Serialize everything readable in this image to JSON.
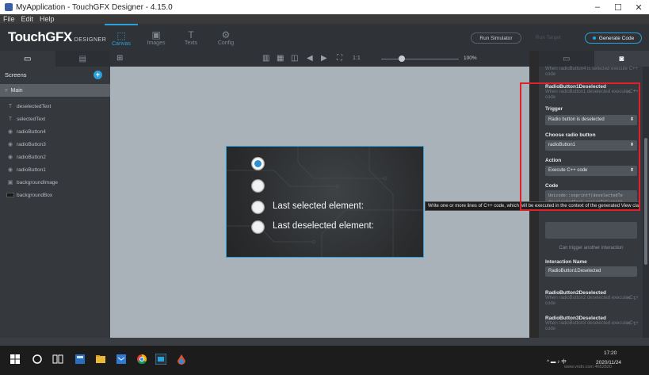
{
  "window": {
    "title": "MyApplication - TouchGFX Designer - 4.15.0",
    "min": "–",
    "max": "☐",
    "close": "✕"
  },
  "menu": [
    "File",
    "Edit",
    "Help"
  ],
  "logo": {
    "main": "TouchGFX",
    "sub": "DESIGNER"
  },
  "tools": [
    {
      "label": "Canvas",
      "icon": "⬚"
    },
    {
      "label": "Images",
      "icon": "▣"
    },
    {
      "label": "Texts",
      "icon": "T"
    },
    {
      "label": "Config",
      "icon": "⚙"
    }
  ],
  "actions": {
    "run_simulator": "Run Simulator",
    "run_target": "Run Target",
    "generate_code": "Generate Code"
  },
  "left_panel": {
    "screens_label": "Screens",
    "screen_name": "Main",
    "widgets": [
      {
        "icon": "T",
        "name": "deselectedText"
      },
      {
        "icon": "T",
        "name": "selectedText"
      },
      {
        "icon": "◉",
        "name": "radioButton4"
      },
      {
        "icon": "◉",
        "name": "radioButton3"
      },
      {
        "icon": "◉",
        "name": "radioButton2"
      },
      {
        "icon": "◉",
        "name": "radioButton1"
      },
      {
        "icon": "▣",
        "name": "backgroundImage"
      },
      {
        "icon": "box",
        "name": "backgroundBox"
      }
    ]
  },
  "canvas": {
    "zoom": "100%",
    "zoom_level": 0.27,
    "preview": {
      "last_selected": "Last selected element:",
      "last_deselected": "Last deselected element:"
    },
    "tooltip": "Write one or more lines of C++ code, which will be executed in the context of the generated View class."
  },
  "right_panel": {
    "prev_interaction_desc": "When radioButton4 is selected execute C++ code",
    "interaction1": {
      "name": "RadioButton1Deselected",
      "desc": "When radioButton1 deselected execute C++ code"
    },
    "trigger_label": "Trigger",
    "trigger_value": "Radio button is deselected",
    "choose_label": "Choose radio button",
    "choose_value": "radioButton1",
    "action_label": "Action",
    "action_value": "Execute C++ code",
    "code_label": "Code",
    "code_line1": "Unicode::snprintf(deselectedTe",
    "code_line2": "deselectedText.resizeToCurrent",
    "trigger_note": "Can trigger another interaction",
    "interaction_name_label": "Interaction Name",
    "interaction_name_value": "RadioButton1Deselected",
    "interaction2": {
      "name": "RadioButton2Deselected",
      "desc": "When radioButton2 deselected execute C++ code"
    },
    "interaction3": {
      "name": "RadioButton3Deselected",
      "desc": "When radioButton3 deselected execute C++ code"
    }
  },
  "taskbar": {
    "time": "17:20",
    "date": "2020/11/24",
    "watermark": "www.vndn.com 4652820"
  },
  "colors": {
    "accent": "#2aa0dc",
    "highlight": "#e0202a",
    "canvas": "#a9b2b9"
  }
}
